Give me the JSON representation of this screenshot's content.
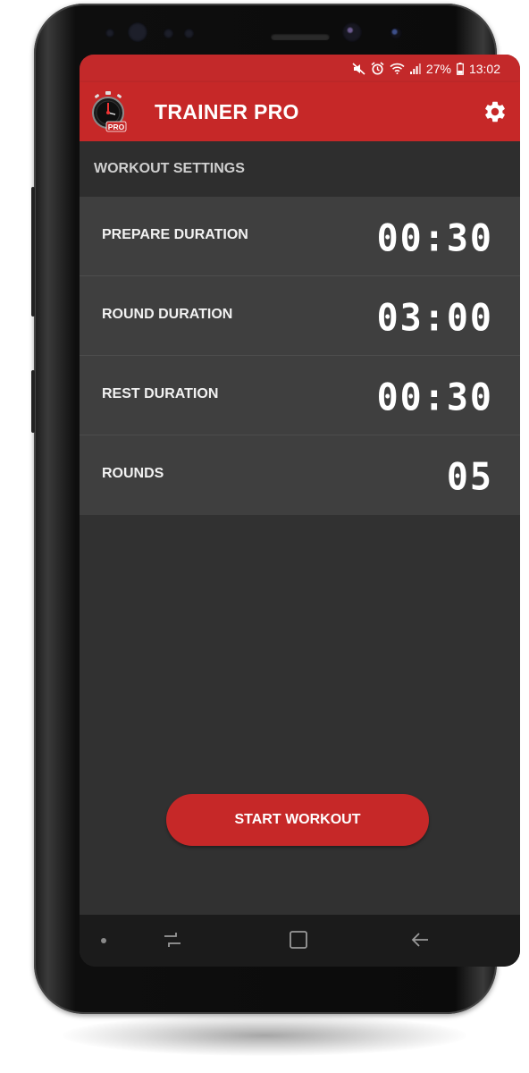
{
  "status_bar": {
    "battery_percent": "27%",
    "time": "13:02",
    "icons": [
      "mute-icon",
      "alarm-icon",
      "wifi-icon",
      "signal-icon",
      "battery-icon"
    ]
  },
  "app_bar": {
    "title": "TRAINER PRO",
    "logo_badge": "PRO",
    "settings_icon": "gear-icon"
  },
  "section": {
    "title": "WORKOUT SETTINGS"
  },
  "settings": [
    {
      "label": "PREPARE DURATION",
      "value": "00:30"
    },
    {
      "label": "ROUND DURATION",
      "value": "03:00"
    },
    {
      "label": "REST DURATION",
      "value": "00:30"
    },
    {
      "label": "ROUNDS",
      "value": "05"
    }
  ],
  "start_button": {
    "label": "START WORKOUT"
  },
  "nav_bar": {
    "items": [
      "dot-icon",
      "recents-icon",
      "home-icon",
      "back-icon"
    ]
  },
  "colors": {
    "accent": "#c62828",
    "background": "#313131",
    "row": "#3f3f3f"
  }
}
